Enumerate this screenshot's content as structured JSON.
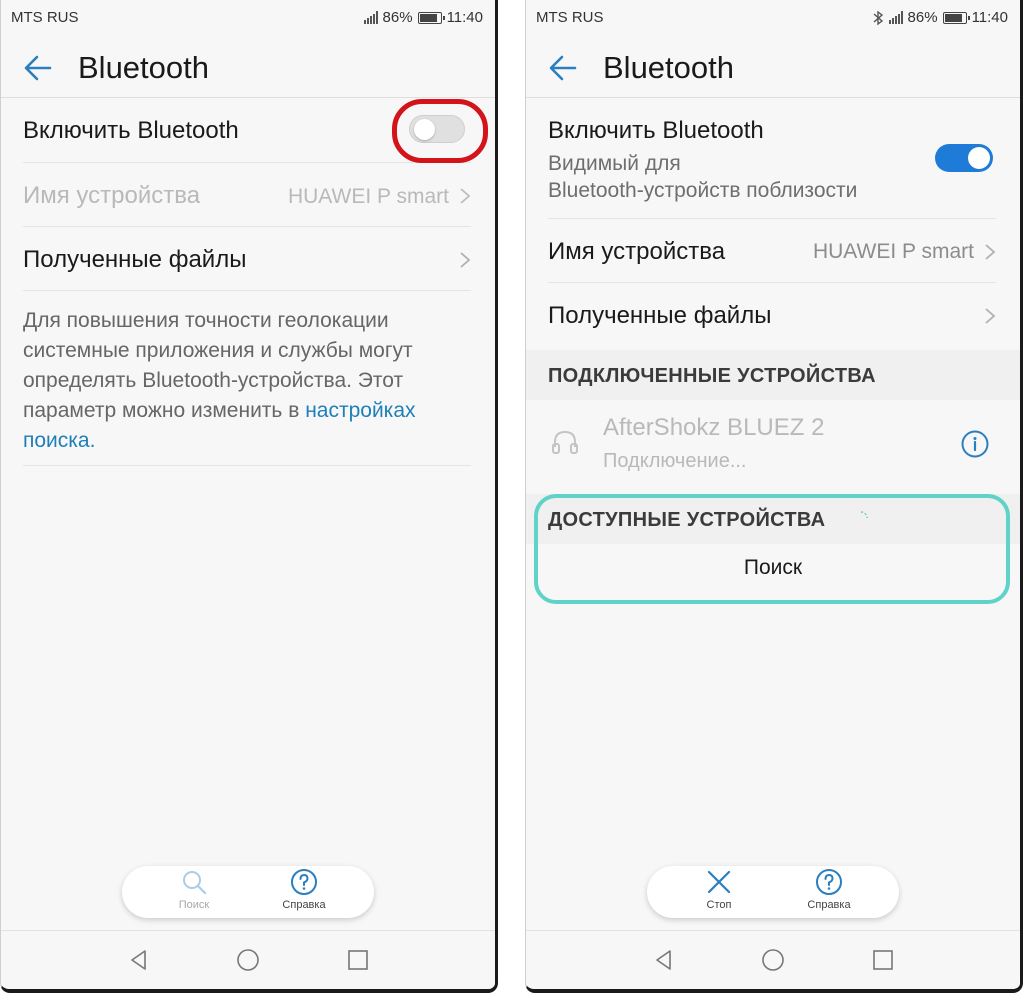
{
  "left": {
    "status": {
      "carrier": "MTS RUS",
      "battery": "86%",
      "time": "11:40"
    },
    "title": "Bluetooth",
    "enable_label": "Включить Bluetooth",
    "bluetooth_enabled": false,
    "device_name_label": "Имя устройства",
    "device_name_value": "HUAWEI P smart",
    "received_files_label": "Полученные файлы",
    "hint_text": "Для повышения точности геолокации системные приложения и службы могут определять Bluetooth-устройства. Этот параметр можно изменить в ",
    "hint_link": "настройках поиска",
    "hint_end": ".",
    "bottom": {
      "search_label": "Поиск",
      "help_label": "Справка"
    },
    "highlight_color": "#d3141b"
  },
  "right": {
    "status": {
      "carrier": "MTS RUS",
      "battery": "86%",
      "time": "11:40"
    },
    "title": "Bluetooth",
    "enable_label": "Включить Bluetooth",
    "visibility_line1": "Видимый для",
    "visibility_line2": "Bluetooth-устройств поблизости",
    "bluetooth_enabled": true,
    "device_name_label": "Имя устройства",
    "device_name_value": "HUAWEI P smart",
    "received_files_label": "Полученные файлы",
    "connected_header": "ПОДКЛЮЧЕННЫЕ УСТРОЙСТВА",
    "connected_device": {
      "name": "AfterShokz BLUEZ 2",
      "status": "Подключение..."
    },
    "available_header": "ДОСТУПНЫЕ УСТРОЙСТВА",
    "searching_text": "Поиск",
    "bottom": {
      "stop_label": "Стоп",
      "help_label": "Справка"
    },
    "highlight_color": "#5fd3c8"
  },
  "colors": {
    "accent": "#1e7bd8",
    "link": "#1f7fb8",
    "back_arrow": "#2a7fc0"
  }
}
